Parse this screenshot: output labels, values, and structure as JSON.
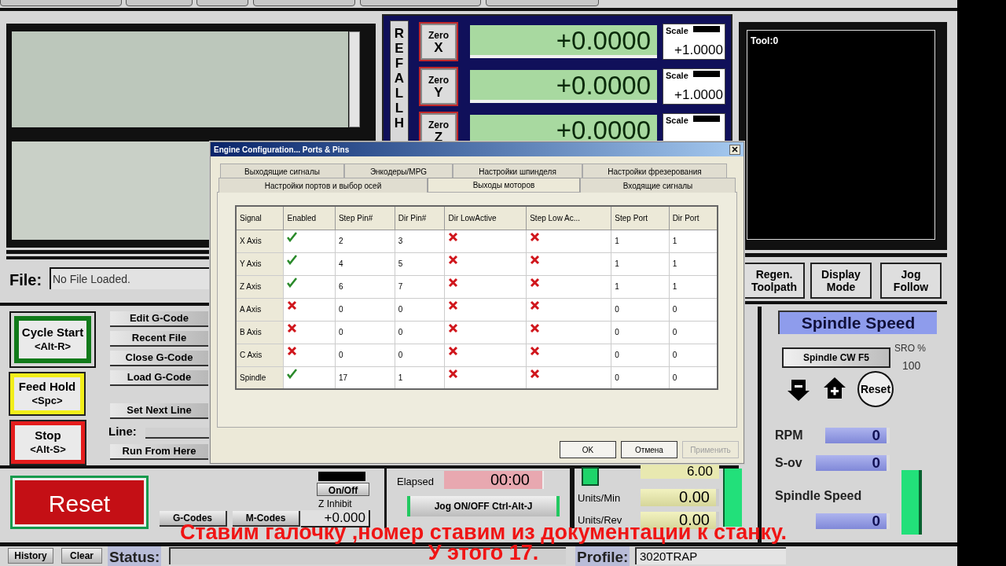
{
  "dro": {
    "ref_all_home": "REFALLH",
    "axes": [
      {
        "zero_label": "Zero",
        "axis": "X",
        "value": "+0.0000",
        "scale_label": "Scale",
        "scale": "+1.0000"
      },
      {
        "zero_label": "Zero",
        "axis": "Y",
        "value": "+0.0000",
        "scale_label": "Scale",
        "scale": "+1.0000"
      },
      {
        "zero_label": "Zero",
        "axis": "Z",
        "value": "+0.0000",
        "scale_label": "Scale"
      }
    ]
  },
  "tool_display": {
    "label": "Tool:0"
  },
  "file": {
    "label": "File:",
    "value": "No File Loaded."
  },
  "run_buttons": [
    {
      "label": "Cycle Start",
      "shortcut": "<Alt-R>",
      "kind": "start"
    },
    {
      "label": "Feed Hold",
      "shortcut": "<Spc>",
      "kind": "hold"
    },
    {
      "label": "Stop",
      "shortcut": "<Alt-S>",
      "kind": "stop"
    }
  ],
  "file_buttons": [
    "Edit G-Code",
    "Recent File",
    "Close G-Code",
    "Load G-Code"
  ],
  "set_next_line": "Set Next Line",
  "line_label": "Line:",
  "run_from_here": "Run From Here",
  "toolpath_buttons": [
    "Regen. Toolpath",
    "Display Mode",
    "Jog Follow"
  ],
  "spindle": {
    "title": "Spindle Speed",
    "cw_button": "Spindle CW F5",
    "sro_label": "SRO %",
    "sro_value": "100",
    "reset": "Reset",
    "readouts": [
      {
        "label": "RPM",
        "value": "0"
      },
      {
        "label": "S-ov",
        "value": "0"
      },
      {
        "label": "Spindle Speed",
        "value": "0"
      }
    ]
  },
  "reset_button": "Reset",
  "z_inhibit": {
    "button": "On/Off",
    "label": "Z Inhibit",
    "value": "+0.000"
  },
  "code_buttons": [
    "G-Codes",
    "M-Codes"
  ],
  "elapsed": {
    "label": "Elapsed",
    "value": "00:00"
  },
  "jog_button": "Jog ON/OFF Ctrl-Alt-J",
  "feed": {
    "value": "6.00",
    "rows": [
      {
        "label": "Units/Min",
        "value": "0.00"
      },
      {
        "label": "Units/Rev",
        "value": "0.00"
      }
    ]
  },
  "status_bar": {
    "history": "History",
    "clear": "Clear",
    "status_label": "Status:",
    "profile_label": "Profile:",
    "profile": "3020TRAP"
  },
  "dialog": {
    "title": "Engine Configuration... Ports & Pins",
    "tab_rows": [
      [
        {
          "label": "Выходящие сигналы",
          "selected": false
        },
        {
          "label": "Энкодеры/MPG",
          "selected": false
        },
        {
          "label": "Настройки шпинделя",
          "selected": false
        },
        {
          "label": "Настройки фрезерования",
          "selected": false
        }
      ],
      [
        {
          "label": "Настройки портов и выбор осей",
          "selected": false
        },
        {
          "label": "Выходы моторов",
          "selected": true
        },
        {
          "label": "Входящие сигналы",
          "selected": false
        }
      ]
    ],
    "table": {
      "columns": [
        "Signal",
        "Enabled",
        "Step Pin#",
        "Dir Pin#",
        "Dir LowActive",
        "Step Low Ac...",
        "Step Port",
        "Dir Port"
      ],
      "rows": [
        {
          "signal": "X Axis",
          "enabled": true,
          "step_pin": "2",
          "dir_pin": "3",
          "dir_low_active": false,
          "step_low_active": false,
          "step_port": "1",
          "dir_port": "1"
        },
        {
          "signal": "Y Axis",
          "enabled": true,
          "step_pin": "4",
          "dir_pin": "5",
          "dir_low_active": false,
          "step_low_active": false,
          "step_port": "1",
          "dir_port": "1"
        },
        {
          "signal": "Z Axis",
          "enabled": true,
          "step_pin": "6",
          "dir_pin": "7",
          "dir_low_active": false,
          "step_low_active": false,
          "step_port": "1",
          "dir_port": "1"
        },
        {
          "signal": "A Axis",
          "enabled": false,
          "step_pin": "0",
          "dir_pin": "0",
          "dir_low_active": false,
          "step_low_active": false,
          "step_port": "0",
          "dir_port": "0"
        },
        {
          "signal": "B Axis",
          "enabled": false,
          "step_pin": "0",
          "dir_pin": "0",
          "dir_low_active": false,
          "step_low_active": false,
          "step_port": "0",
          "dir_port": "0"
        },
        {
          "signal": "C Axis",
          "enabled": false,
          "step_pin": "0",
          "dir_pin": "0",
          "dir_low_active": false,
          "step_low_active": false,
          "step_port": "0",
          "dir_port": "0"
        },
        {
          "signal": "Spindle",
          "enabled": true,
          "step_pin": "17",
          "dir_pin": "1",
          "dir_low_active": false,
          "step_low_active": false,
          "step_port": "0",
          "dir_port": "0"
        }
      ]
    },
    "buttons": [
      {
        "label": "OK",
        "disabled": false
      },
      {
        "label": "Отмена",
        "disabled": false
      },
      {
        "label": "Применить",
        "disabled": true
      }
    ]
  },
  "subtitle": [
    "Ставим галочку ,номер ставим из документации к станку.",
    "У этого 17."
  ]
}
